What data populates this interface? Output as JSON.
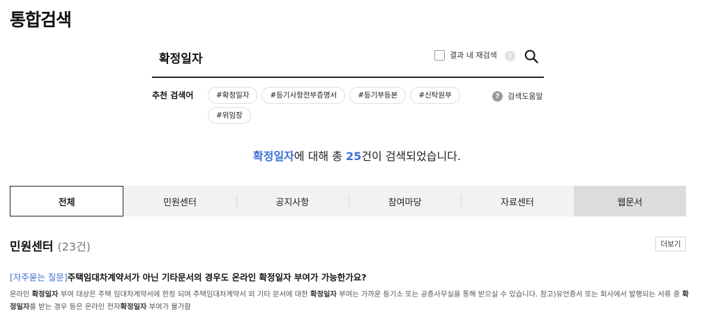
{
  "page": {
    "title": "통합검색"
  },
  "search": {
    "query": "확정일자",
    "within_results_label": "결과 내 재검색",
    "clear_symbol": "×"
  },
  "recommended": {
    "label": "추천 검색어",
    "tags": [
      "#확정일자",
      "#등기사항전부증명서",
      "#등기부등본",
      "#신탁원부",
      "#위임장"
    ]
  },
  "help": {
    "icon_text": "?",
    "label": "검색도움말"
  },
  "summary": {
    "keyword": "확정일자",
    "text_mid": "에 대해 총 ",
    "count": "25",
    "text_end": "건이 검색되었습니다."
  },
  "tabs": [
    {
      "label": "전체",
      "state": "active"
    },
    {
      "label": "민원센터",
      "state": ""
    },
    {
      "label": "공지사항",
      "state": ""
    },
    {
      "label": "참여마당",
      "state": ""
    },
    {
      "label": "자료센터",
      "state": ""
    },
    {
      "label": "웹문서",
      "state": "dark"
    }
  ],
  "section": {
    "title": "민원센터",
    "count": "(23건)",
    "more_label": "더보기"
  },
  "result": {
    "category": "[자주묻는 질문]",
    "title_pre": "주택임대차계약서가 아닌 기타문서의 경우도 온라인 ",
    "title_keyword": "확정일자",
    "title_post": " 부여가 가능한가요?",
    "body_parts": [
      {
        "t": "온라인 ",
        "b": false
      },
      {
        "t": "확정일자",
        "b": true
      },
      {
        "t": " 부여 대상은 주택 임대차계약서에 한정 되며 주택임대차계약서 외 기타 문서에 대한 ",
        "b": false
      },
      {
        "t": "확정일자",
        "b": true
      },
      {
        "t": " 부여는 가까운 등기소 또는 공증사무실을 통해 받으실 수 있습니다. 참고)유언증서 또는 회사에서 발행되는 서류 중 ",
        "b": false
      },
      {
        "t": "확정일자",
        "b": true
      },
      {
        "t": "를 받는 경우 등은 온라인 전자",
        "b": false
      },
      {
        "t": "확정일자",
        "b": true
      },
      {
        "t": " 부여가 불가함",
        "b": false
      }
    ]
  },
  "colors": {
    "accent": "#3b6fd6",
    "tab_bg": "#f2f2f2",
    "tab_dark": "#dcdcdc"
  }
}
